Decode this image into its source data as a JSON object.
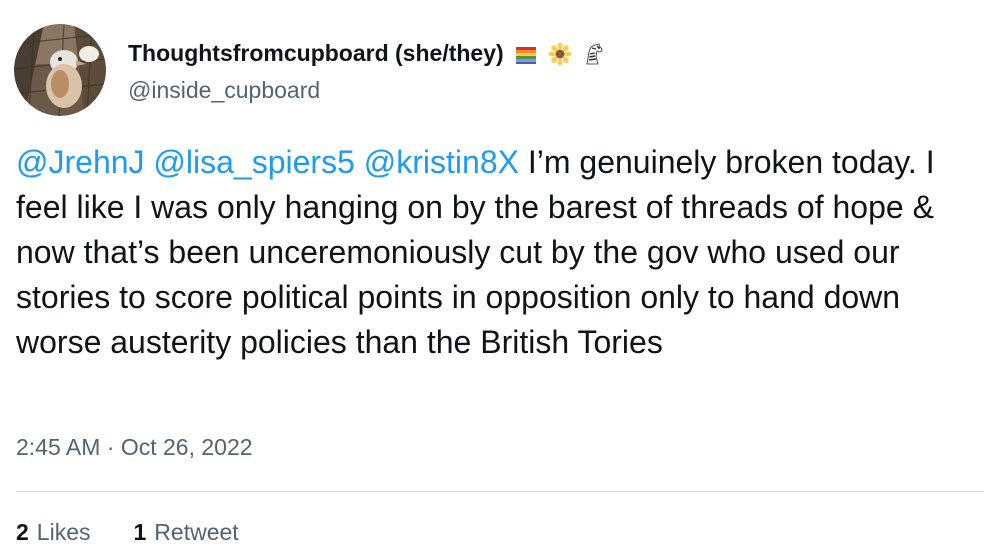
{
  "author": {
    "display_name": "Thoughtsfromcupboard (she/they)",
    "handle": "@inside_cupboard",
    "name_emojis": [
      "rainbow-flag-icon",
      "sunflower-icon",
      "zebra-icon"
    ]
  },
  "tweet": {
    "mentions": [
      "@JrehnJ",
      "@lisa_spiers5",
      "@kristin8X"
    ],
    "text": "I’m genuinely broken today. I feel like I was only hanging on by the barest of threads of hope & now that’s been unceremoniously cut by the gov who used our stories to score political points in opposition only to hand down worse austerity policies than the British Tories",
    "timestamp": "2:45 AM · Oct 26, 2022"
  },
  "stats": {
    "likes_count": "2",
    "likes_label": "Likes",
    "retweets_count": "1",
    "retweets_label": "Retweet"
  },
  "colors": {
    "link": "#1d9bf0",
    "secondary_text": "#536471",
    "primary_text": "#0f1419",
    "divider": "#cfd9de"
  }
}
